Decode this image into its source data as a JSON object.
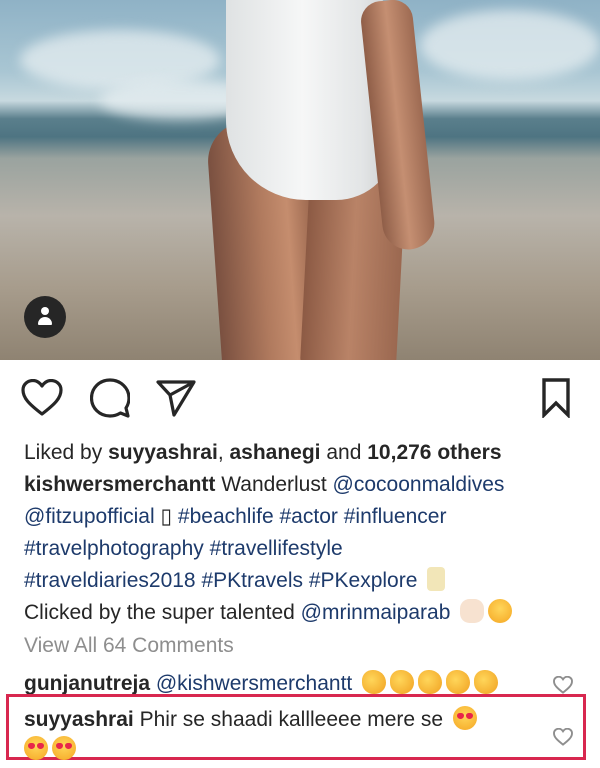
{
  "post": {
    "liked_by_prefix": "Liked by ",
    "liked_user1": "suyyashrai",
    "liked_sep": ", ",
    "liked_user2": "ashanegi",
    "liked_and": " and ",
    "liked_count": "10,276 others",
    "author": "kishwersmerchantt",
    "caption_text": " Wanderlust ",
    "mention1": "@cocoonmaldives",
    "mention2": "@fitzupofficial",
    "caption_glyph": "▯",
    "tags_line1": [
      "#beachlife",
      "#actor",
      "#influencer"
    ],
    "tags_line2": [
      "#travelphotography",
      "#travellifestyle"
    ],
    "tags_line3": [
      "#traveldiaries2018",
      "#PKtravels",
      "#PKexplore"
    ],
    "credit_text": "Clicked by the super talented ",
    "credit_mention": "@mrinmaiparab"
  },
  "comments": {
    "view_all": "View All 64 Comments",
    "c1_user": "gunjanutreja",
    "c1_text": "@kishwersmerchantt",
    "c2_user": "suyyashrai",
    "c2_text": "Phir se shaadi kallleeee mere se"
  },
  "icons": {
    "like": "heart-outline-icon",
    "comment": "speech-bubble-icon",
    "share": "paper-plane-icon",
    "save": "bookmark-icon",
    "user_tag": "person-icon"
  },
  "colors": {
    "link": "#1d3a6b",
    "muted": "#8e8e8e",
    "highlight": "#d8274f"
  }
}
